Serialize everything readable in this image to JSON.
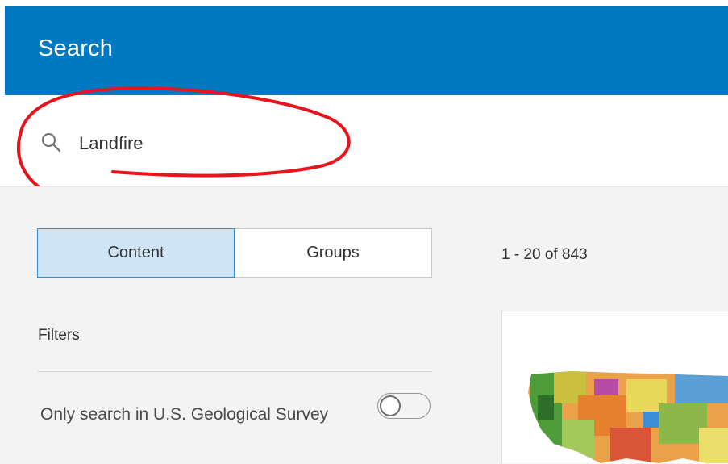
{
  "header": {
    "title": "Search"
  },
  "search": {
    "value": "Landfire",
    "placeholder": ""
  },
  "tabs": [
    {
      "label": "Content",
      "selected": true
    },
    {
      "label": "Groups",
      "selected": false
    }
  ],
  "results": {
    "count_text": "1 - 20 of 843"
  },
  "filters": {
    "label": "Filters",
    "toggle_label": "Only search in U.S. Geological Survey",
    "toggle_on": false
  },
  "colors": {
    "header": "#0079c1",
    "tab_selected_bg": "#cfe4f7",
    "tab_selected_border": "#2e8bd4",
    "annotation": "#e8141c"
  },
  "icons": {
    "search": "search-icon"
  }
}
